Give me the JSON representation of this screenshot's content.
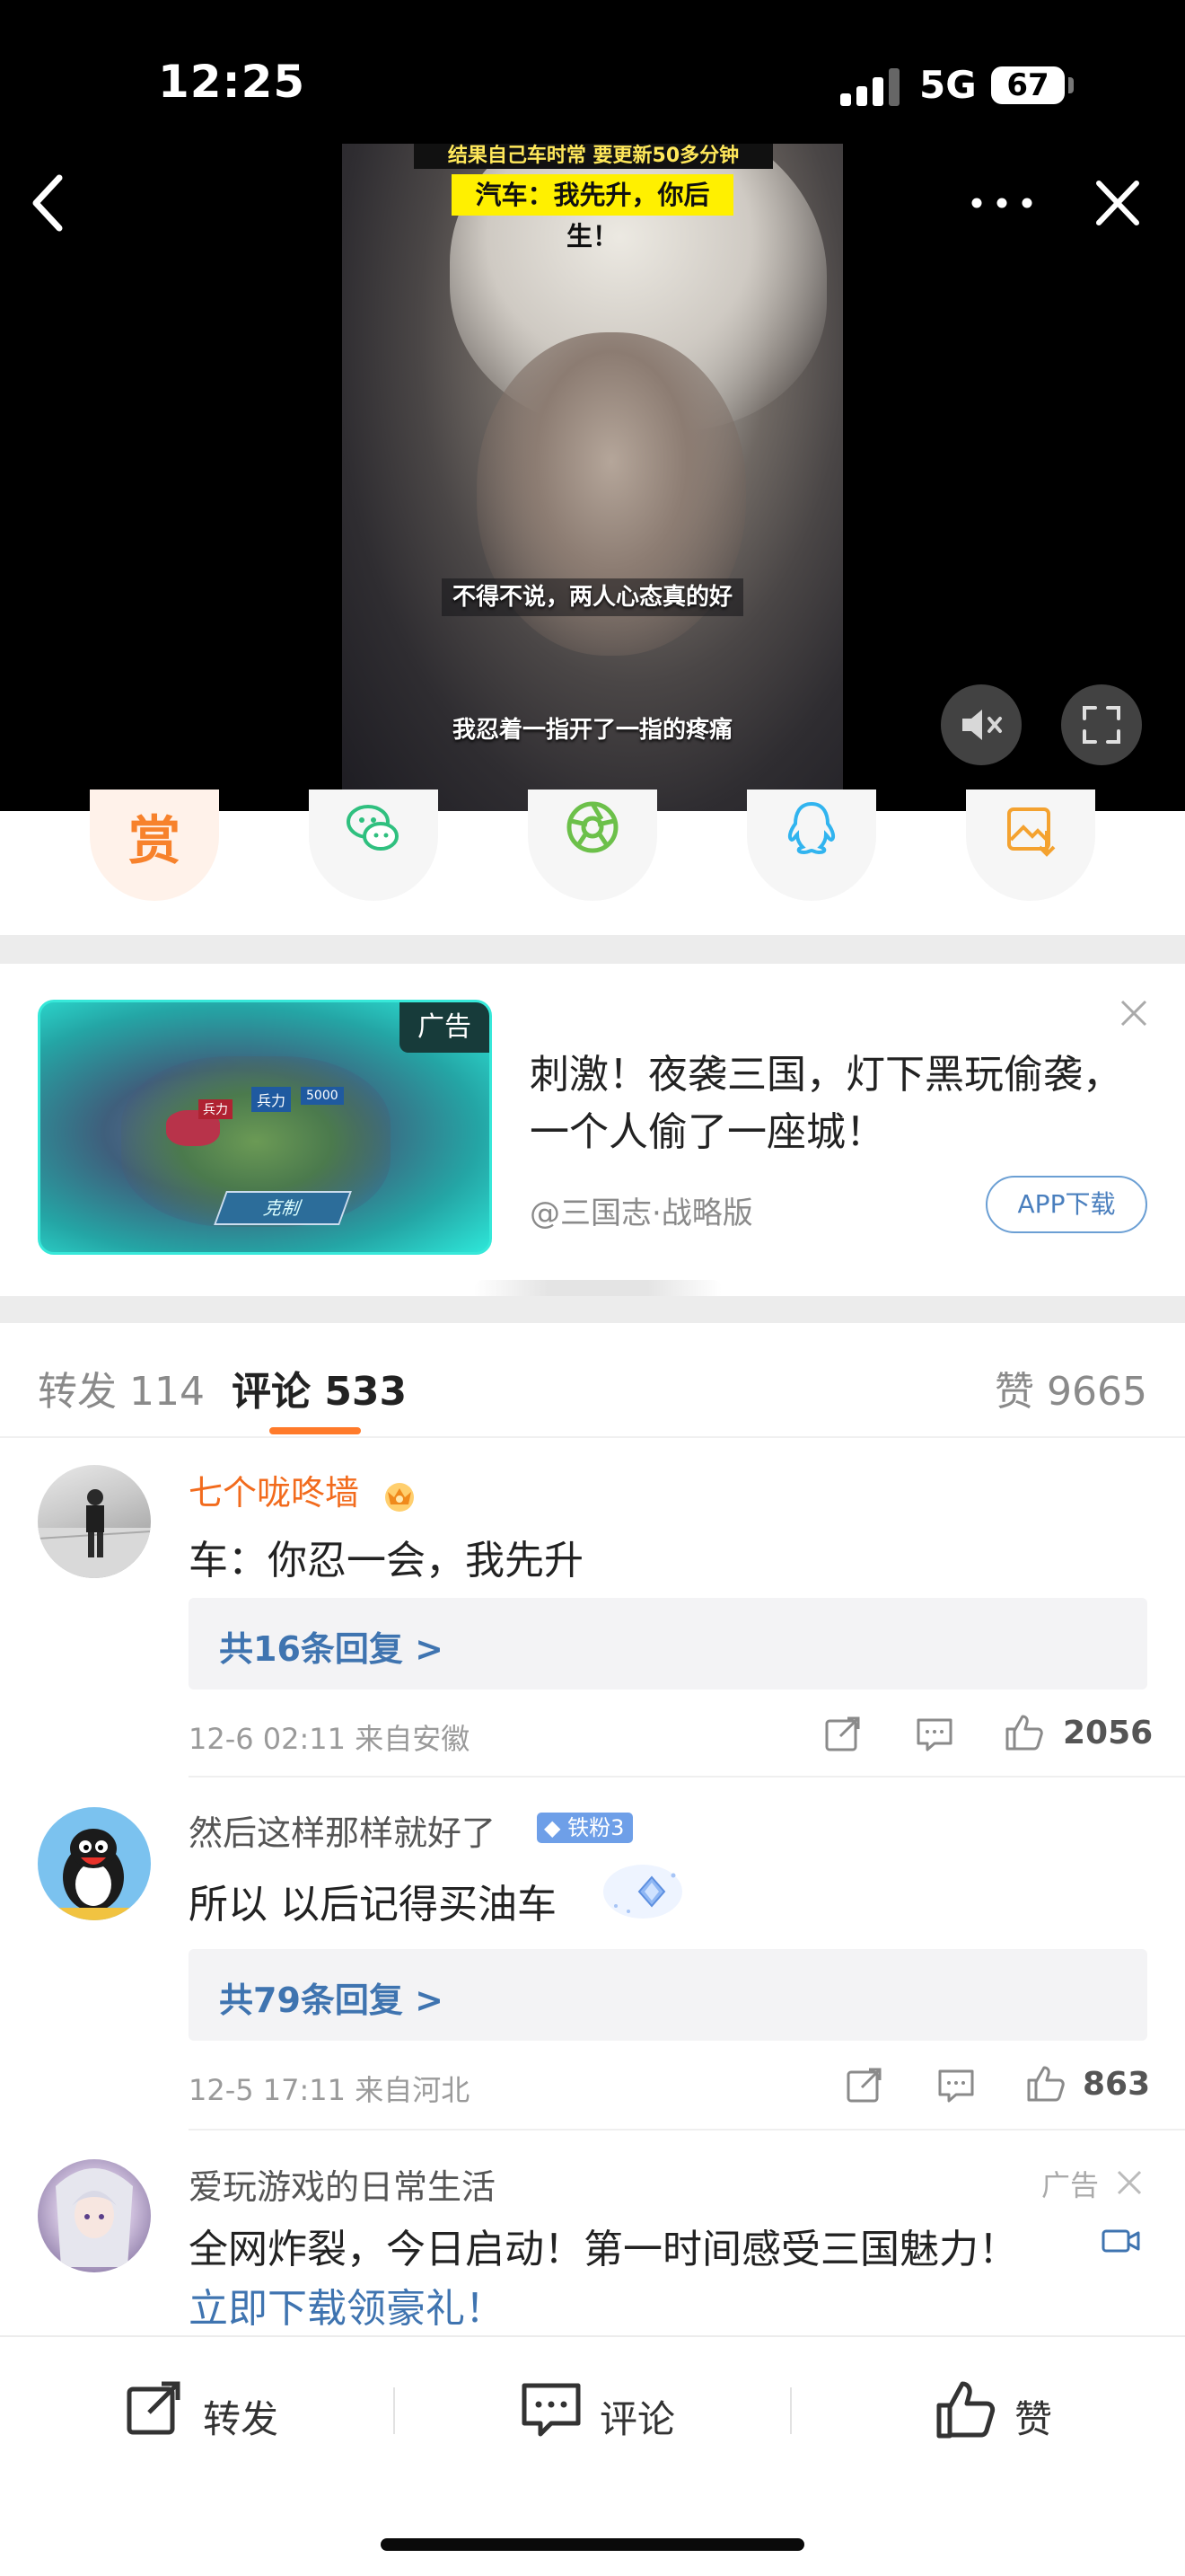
{
  "status_bar": {
    "time": "12:25",
    "network": "5G",
    "battery": "67"
  },
  "video": {
    "top_banner": "结果自己车时常 要更新50多分钟",
    "yellow_banner": "汽车：我先升，你后生！",
    "subtitle_1": "不得不说，两人心态真的好",
    "subtitle_2": "我忍着一指开了一指的疼痛"
  },
  "share_row": {
    "reward_label": "赏"
  },
  "ad": {
    "tag": "广告",
    "title": "刺激！夜袭三国，灯下黑玩偷袭，一个人偷了一座城！",
    "source": "@三国志·战略版",
    "download": "APP下载",
    "image_labels": {
      "a": "兵力",
      "b": "兵力",
      "c": "5000",
      "skill": "克制"
    }
  },
  "tabs": {
    "forward": "转发 114",
    "comment": "评论 533",
    "like": "赞 9665"
  },
  "comments": [
    {
      "name": "七个咙咚墙",
      "text": "车：你忍一会，我先升",
      "replies": "共16条回复 >",
      "meta": "12-6 02:11  来自安徽",
      "likes": "2056"
    },
    {
      "name": "然后这样那样就好了",
      "badge": "铁粉3",
      "text": "所以 以后记得买油车",
      "replies": "共79条回复 >",
      "meta": "12-5 17:11  来自河北",
      "likes": "863"
    }
  ],
  "ad_comment": {
    "name": "爱玩游戏的日常生活",
    "tag": "广告",
    "text": "全网炸裂，今日启动！第一时间感受三国魅力！",
    "link": "立即下载领豪礼！"
  },
  "bottom_bar": {
    "forward": "转发",
    "comment": "评论",
    "like": "赞"
  },
  "colors": {
    "accent_orange": "#ff7a2a",
    "link_blue": "#3f74b0",
    "name_orange": "#f26b1d"
  }
}
